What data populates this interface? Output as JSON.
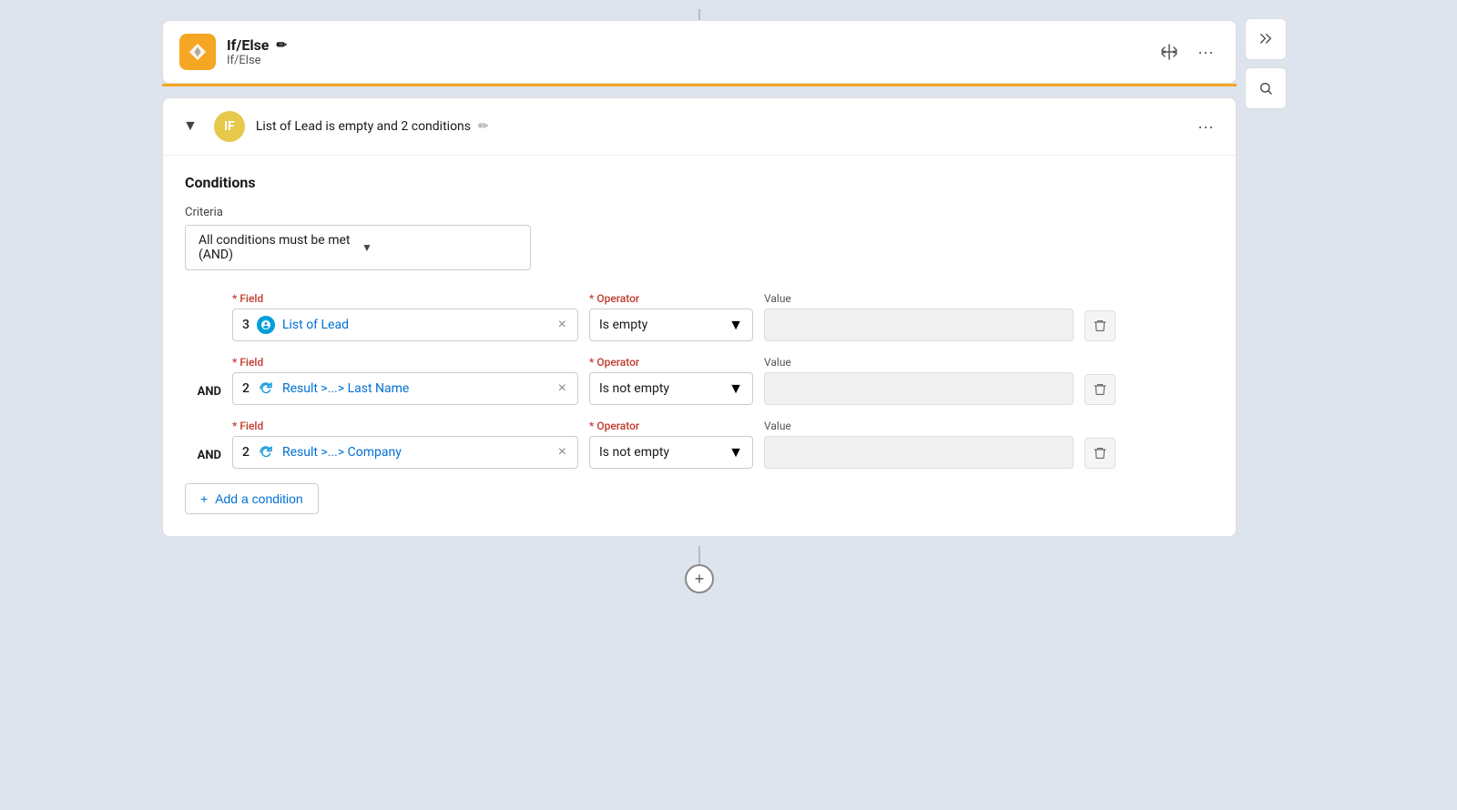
{
  "header": {
    "icon_label": "If/Else",
    "title": "If/Else",
    "subtitle": "If/Else",
    "edit_icon": "✏",
    "move_icon": "⊕",
    "more_icon": "···"
  },
  "if_section": {
    "badge_label": "IF",
    "condition_summary": "List of Lead is empty and 2 conditions",
    "edit_icon": "✏",
    "more_icon": "···",
    "conditions_title": "Conditions",
    "criteria_label": "Criteria",
    "criteria_value": "All conditions must be met (AND)",
    "rows": [
      {
        "and_label": "",
        "field_label": "Field",
        "field_num": "3",
        "field_icon": "salesforce",
        "field_text": "List of Lead",
        "operator_label": "Operator",
        "operator_value": "Is empty",
        "value_label": "Value",
        "value": ""
      },
      {
        "and_label": "AND",
        "field_label": "Field",
        "field_num": "2",
        "field_icon": "refresh",
        "field_text": "Result >...> Last Name",
        "operator_label": "Operator",
        "operator_value": "Is not empty",
        "value_label": "Value",
        "value": ""
      },
      {
        "and_label": "AND",
        "field_label": "Field",
        "field_num": "2",
        "field_icon": "refresh",
        "field_text": "Result >...> Company",
        "operator_label": "Operator",
        "operator_value": "Is not empty",
        "value_label": "Value",
        "value": ""
      }
    ],
    "add_condition_label": "Add a condition"
  },
  "right_panel": {
    "move_icon": "⊕",
    "search_icon": "🔍",
    "collapse_icon": "⤡"
  },
  "bottom": {
    "add_icon": "+"
  }
}
